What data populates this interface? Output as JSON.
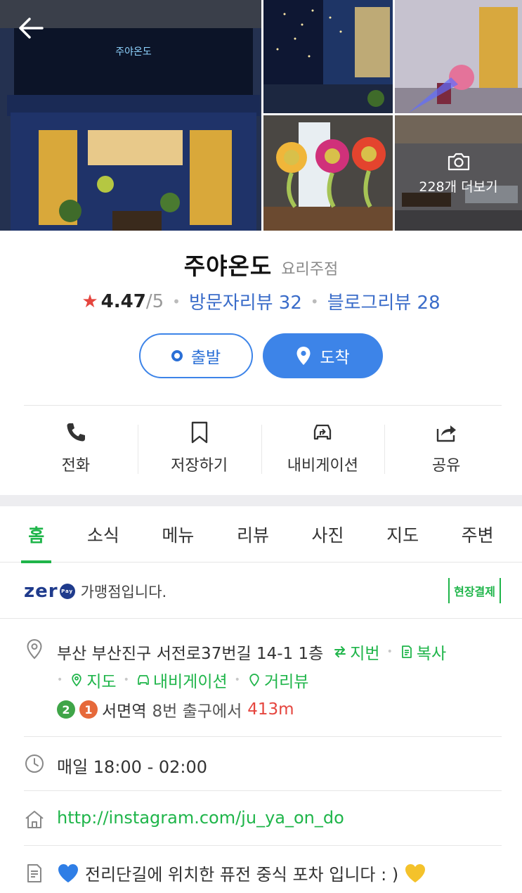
{
  "header": {
    "more_photos": "228개 더보기"
  },
  "place": {
    "name": "주야온도",
    "category": "요리주점",
    "sign_text": "주야온도",
    "rating": "4.47",
    "rating_max": "/5",
    "visitor_reviews": "방문자리뷰 32",
    "blog_reviews": "블로그리뷰 28"
  },
  "route": {
    "depart": "출발",
    "arrive": "도착"
  },
  "actions": [
    {
      "label": "전화",
      "icon": "phone-icon"
    },
    {
      "label": "저장하기",
      "icon": "bookmark-icon"
    },
    {
      "label": "내비게이션",
      "icon": "car-navigation-icon"
    },
    {
      "label": "공유",
      "icon": "share-icon"
    }
  ],
  "tabs": [
    "홈",
    "소식",
    "메뉴",
    "리뷰",
    "사진",
    "지도",
    "주변"
  ],
  "active_tab": "홈",
  "zeropay": {
    "logo": "zer",
    "logo_badge": "Pay",
    "text": "가맹점입니다.",
    "onsite": "현장결제"
  },
  "address": {
    "text": "부산 부산진구 서전로37번길 14-1 1층",
    "lot_number": "지번",
    "copy": "복사",
    "map": "지도",
    "navigation": "내비게이션",
    "street_view": "거리뷰",
    "line_badges": [
      "2",
      "1"
    ],
    "station": "서면역",
    "exit": "8번 출구에서",
    "distance": "413m"
  },
  "hours": "매일 18:00 - 02:00",
  "homepage": "http://instagram.com/ju_ya_on_do",
  "description": "전리단길에 위치한 퓨전 중식 포차 입니다 : )",
  "colors": {
    "brand_green": "#1fb54a",
    "route_blue": "#3d84e8",
    "review_blue": "#3a6cc9",
    "star_red": "#e5453e",
    "zeropay_navy": "#1f3b8c"
  }
}
